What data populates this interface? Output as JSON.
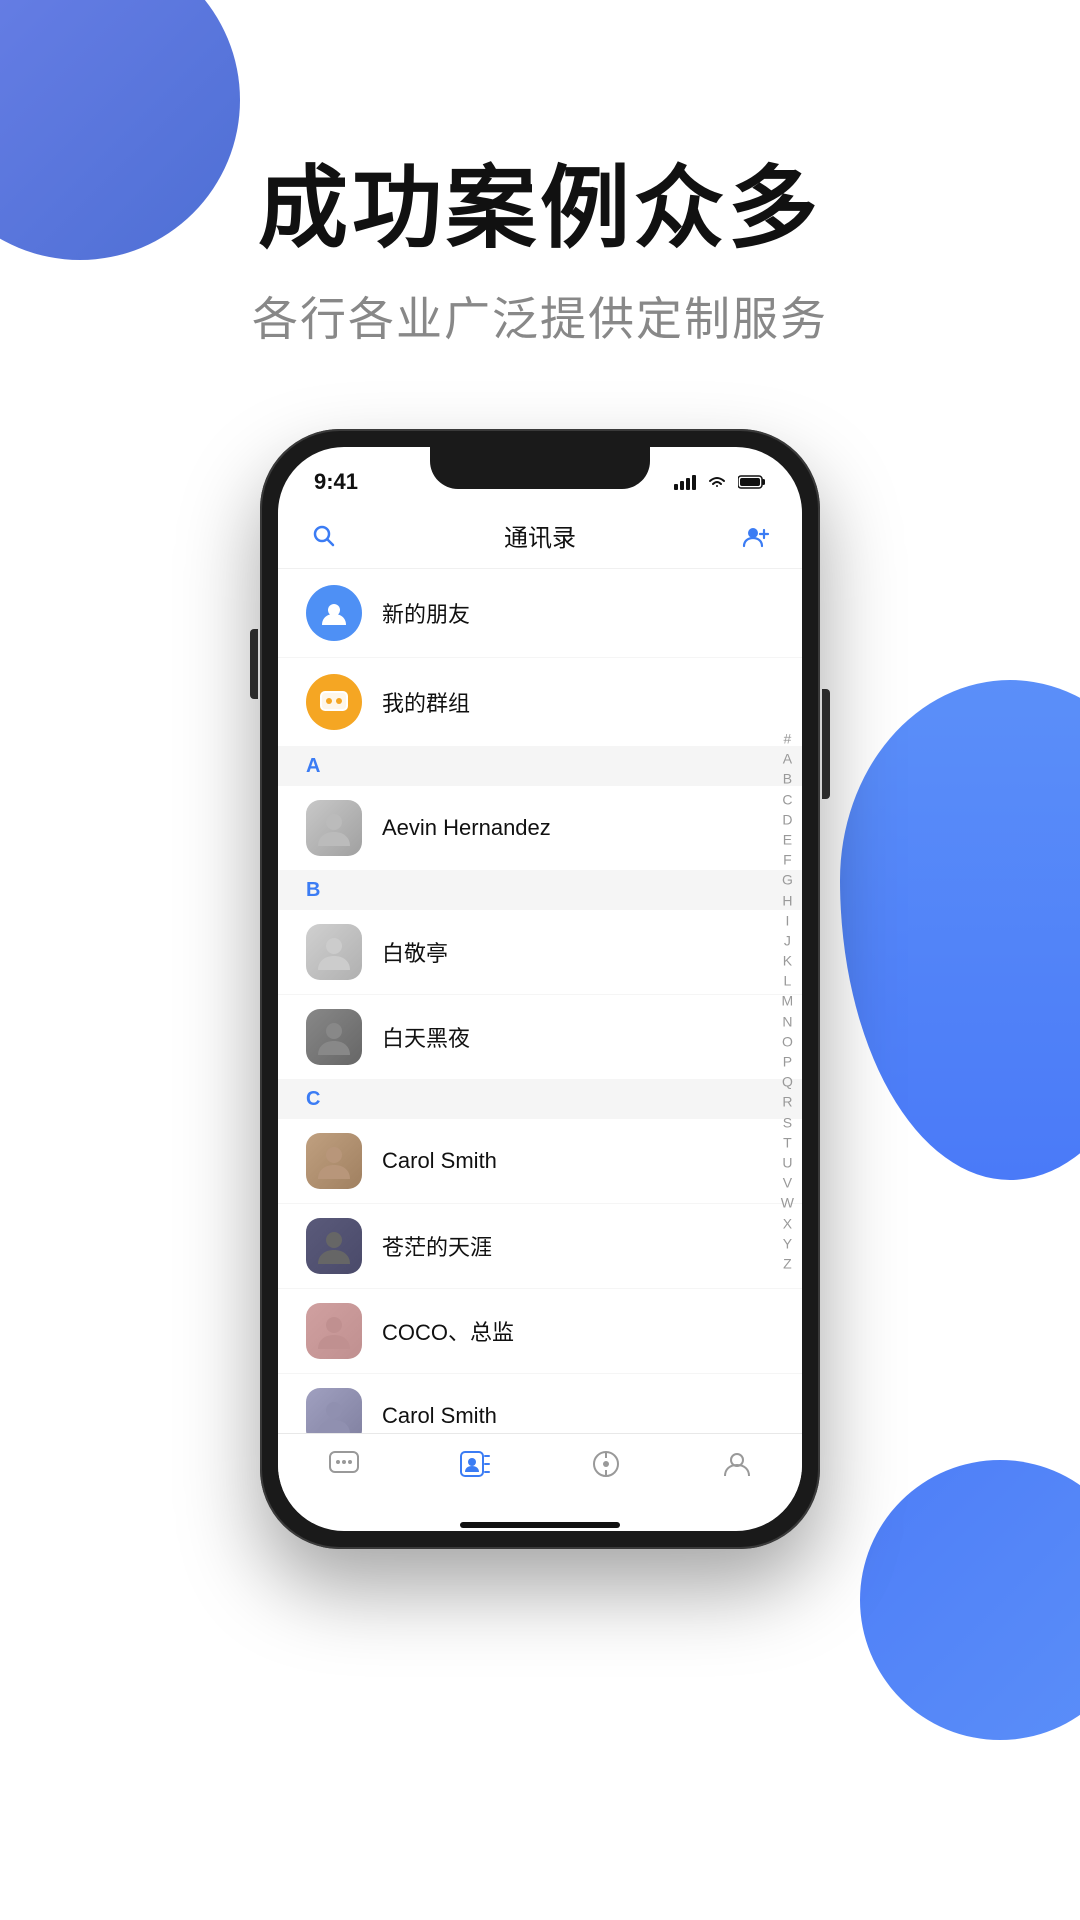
{
  "page": {
    "header_title": "成功案例众多",
    "header_subtitle": "各行各业广泛提供定制服务"
  },
  "phone": {
    "status_bar": {
      "time": "9:41"
    },
    "nav": {
      "title": "通讯录"
    },
    "special_items": [
      {
        "id": "new-friends",
        "name": "新的朋友",
        "icon_type": "person",
        "color": "blue"
      },
      {
        "id": "my-groups",
        "name": "我的群组",
        "icon_type": "chat",
        "color": "yellow"
      }
    ],
    "sections": [
      {
        "letter": "A",
        "contacts": [
          {
            "id": "aevin",
            "name": "Aevin Hernandez",
            "avatar_class": "av-aevin"
          }
        ]
      },
      {
        "letter": "B",
        "contacts": [
          {
            "id": "baijing",
            "name": "白敬亭",
            "avatar_class": "av-baijing"
          },
          {
            "id": "baitianheiye",
            "name": "白天黑夜",
            "avatar_class": "av-baitianheiye"
          }
        ]
      },
      {
        "letter": "C",
        "contacts": [
          {
            "id": "carolsmith1",
            "name": "Carol Smith",
            "avatar_class": "av-carolsmith"
          },
          {
            "id": "cangmao",
            "name": "苍茫的天涯",
            "avatar_class": "av-cangmao"
          },
          {
            "id": "coco",
            "name": "COCO、总监",
            "avatar_class": "av-coco"
          },
          {
            "id": "carolsmith2",
            "name": "Carol Smith",
            "avatar_class": "av-carolsmith2"
          }
        ]
      }
    ],
    "alphabet_index": [
      "#",
      "A",
      "B",
      "C",
      "D",
      "E",
      "F",
      "G",
      "H",
      "I",
      "J",
      "K",
      "L",
      "M",
      "N",
      "O",
      "P",
      "Q",
      "R",
      "S",
      "T",
      "U",
      "V",
      "W",
      "X",
      "Y",
      "Z"
    ],
    "tab_bar": [
      {
        "id": "chat",
        "label": "",
        "icon": "chat",
        "active": false
      },
      {
        "id": "contacts",
        "label": "",
        "icon": "contacts",
        "active": true
      },
      {
        "id": "discover",
        "label": "",
        "icon": "discover",
        "active": false
      },
      {
        "id": "profile",
        "label": "",
        "icon": "profile",
        "active": false
      }
    ]
  }
}
